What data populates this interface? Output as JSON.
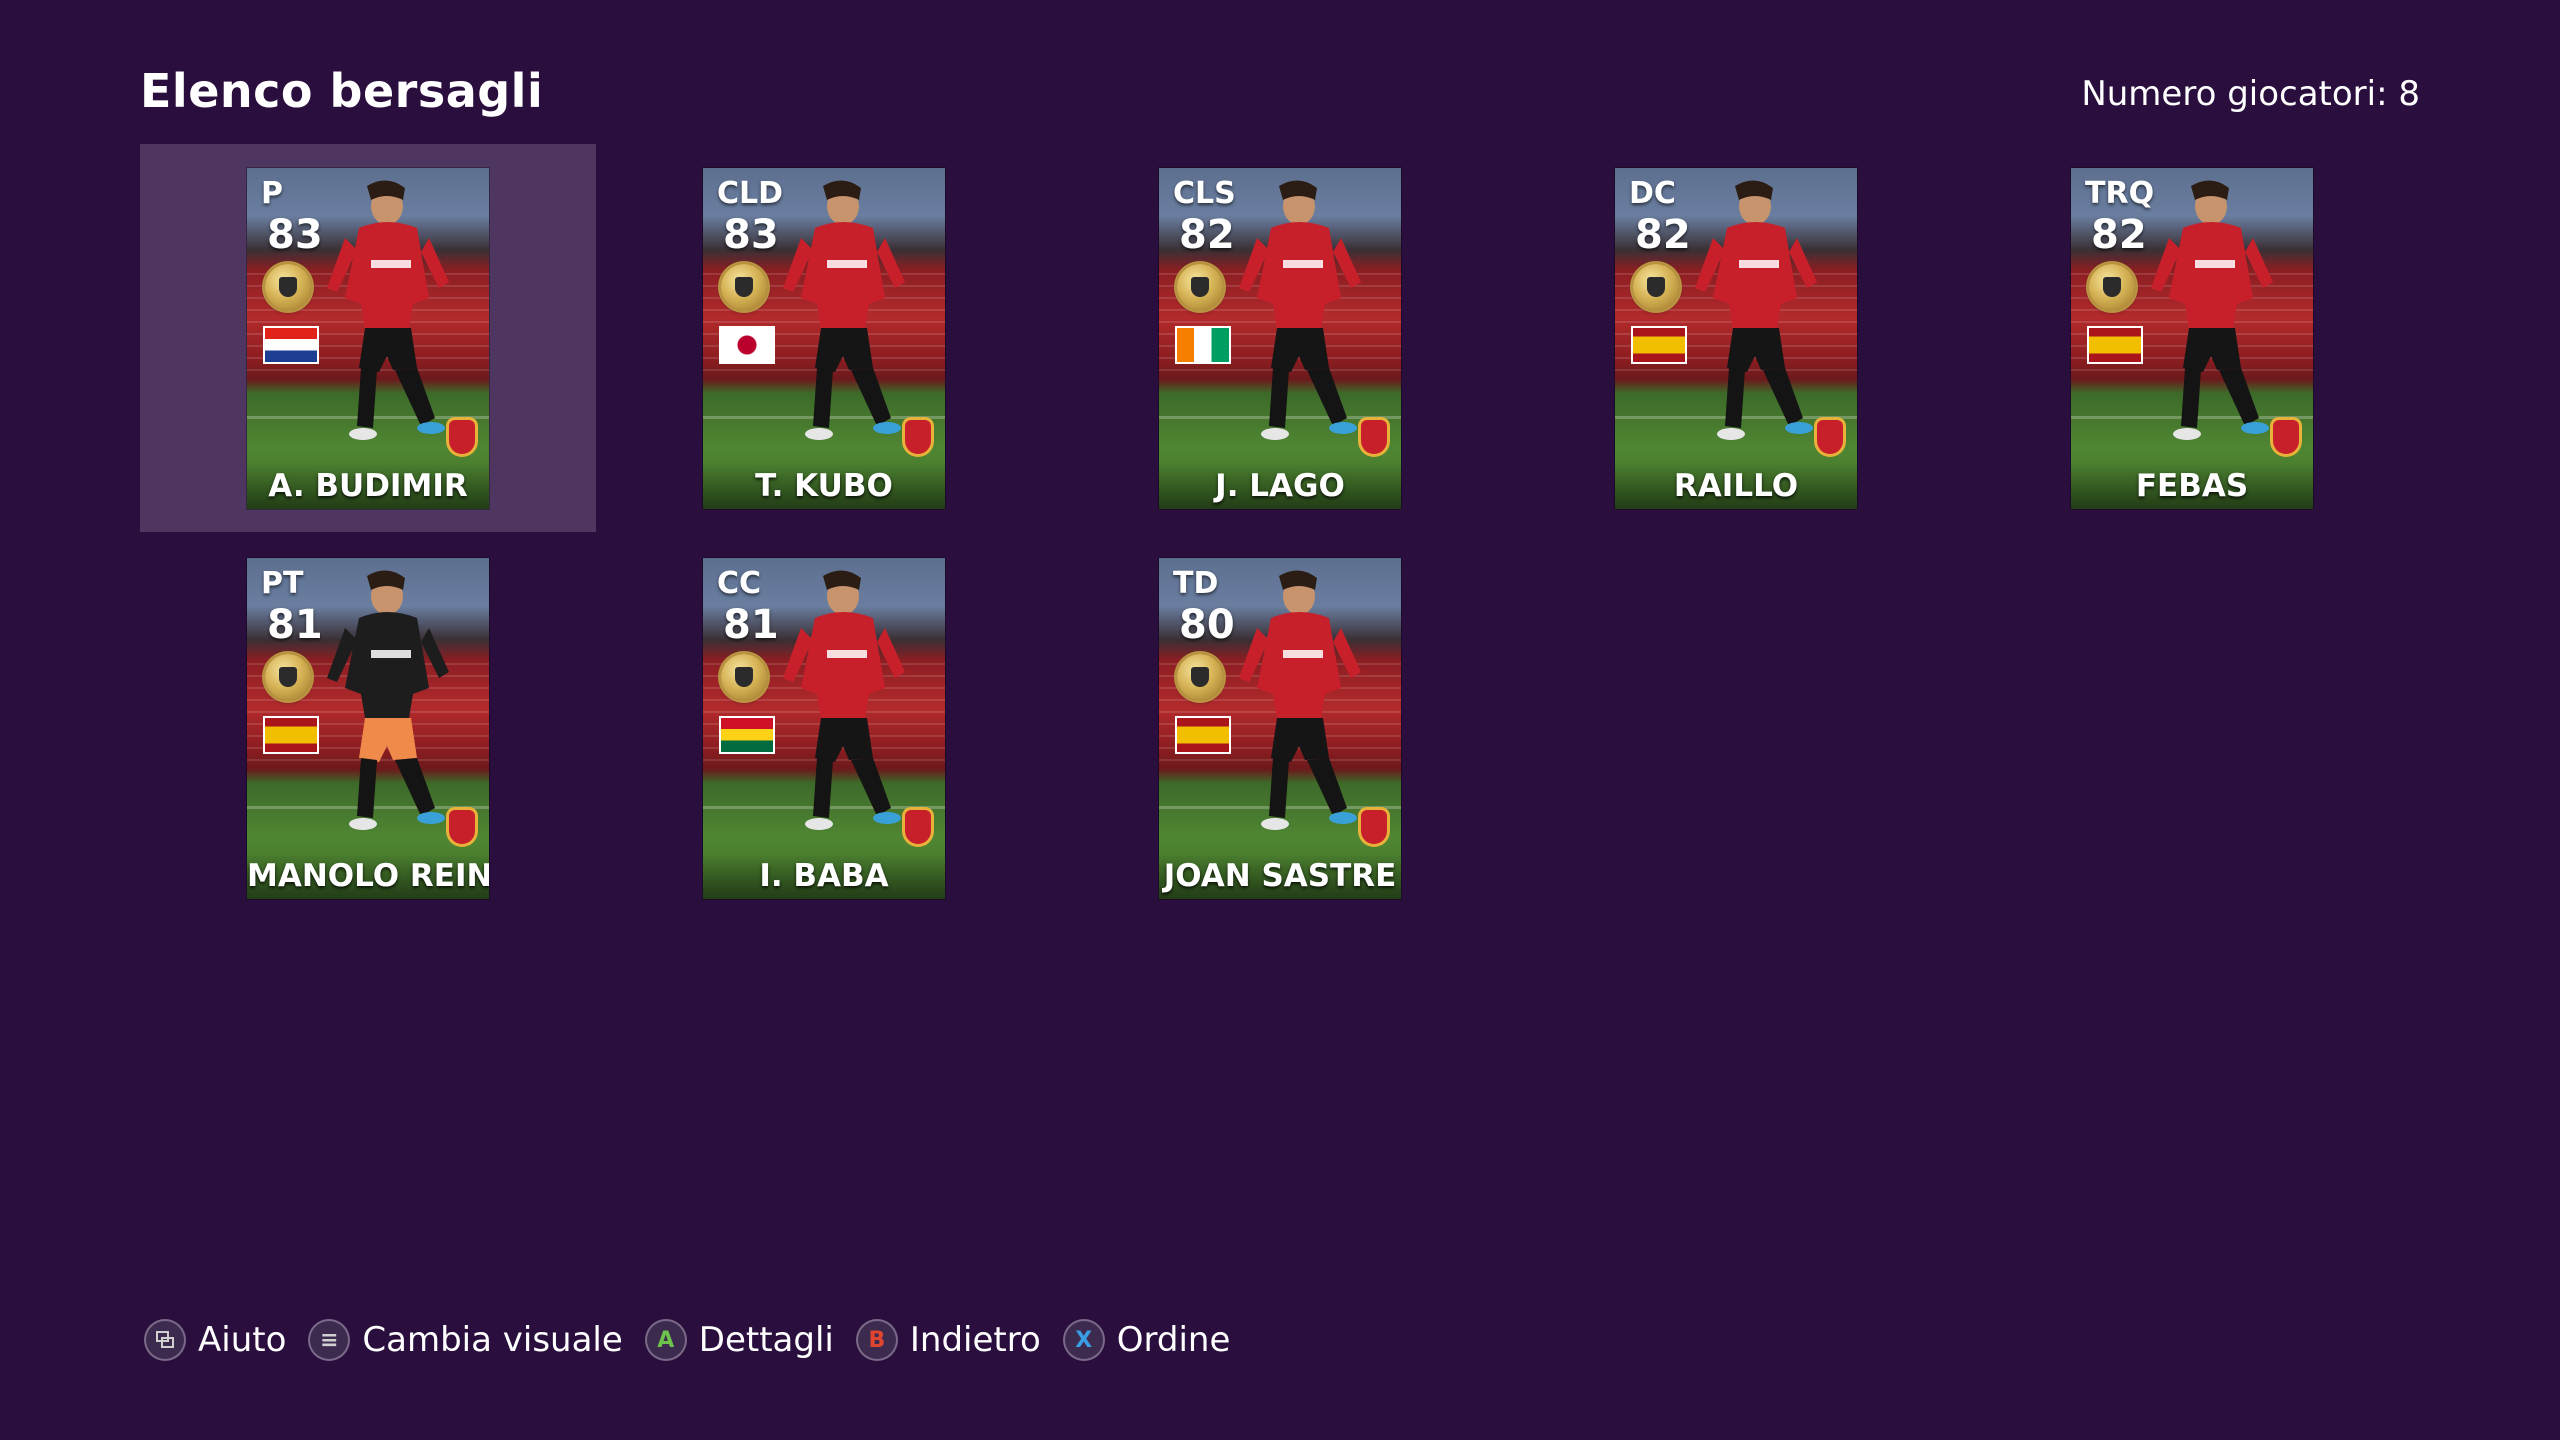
{
  "screen": {
    "title": "Elenco bersagli",
    "player_count_label": "Numero giocatori: 8"
  },
  "players": [
    {
      "position": "P",
      "rating": "83",
      "name": "A. BUDIMIR",
      "nationality": "Croatia",
      "flag": "croatia",
      "selected": true
    },
    {
      "position": "CLD",
      "rating": "83",
      "name": "T. KUBO",
      "nationality": "Japan",
      "flag": "japan",
      "selected": false
    },
    {
      "position": "CLS",
      "rating": "82",
      "name": "J. LAGO",
      "nationality": "Ivory Coast",
      "flag": "ivory-coast",
      "selected": false
    },
    {
      "position": "DC",
      "rating": "82",
      "name": "RAILLO",
      "nationality": "Spain",
      "flag": "spain",
      "selected": false
    },
    {
      "position": "TRQ",
      "rating": "82",
      "name": "FEBAS",
      "nationality": "Spain",
      "flag": "spain",
      "selected": false
    },
    {
      "position": "PT",
      "rating": "81",
      "name": "MANOLO REINA",
      "nationality": "Spain",
      "flag": "spain",
      "selected": false
    },
    {
      "position": "CC",
      "rating": "81",
      "name": "I. BABA",
      "nationality": "Ghana",
      "flag": "ghana",
      "selected": false
    },
    {
      "position": "TD",
      "rating": "80",
      "name": "JOAN SASTRE",
      "nationality": "Spain",
      "flag": "spain",
      "selected": false
    }
  ],
  "footer": {
    "hints": [
      {
        "button": "",
        "icon": "view-icon",
        "label": "Aiuto",
        "color": "#d0d0d0"
      },
      {
        "button": "≡",
        "icon": "menu-icon",
        "label": "Cambia visuale",
        "color": "#d0d0d0"
      },
      {
        "button": "A",
        "icon": "a-button-icon",
        "label": "Dettagli",
        "color": "#6cc24a"
      },
      {
        "button": "B",
        "icon": "b-button-icon",
        "label": "Indietro",
        "color": "#e0452f"
      },
      {
        "button": "X",
        "icon": "x-button-icon",
        "label": "Ordine",
        "color": "#3a9ee4"
      }
    ]
  },
  "colors": {
    "background": "#2a0f3e",
    "selected_slot": "#4e3660",
    "kit_red": "#c8202a"
  }
}
